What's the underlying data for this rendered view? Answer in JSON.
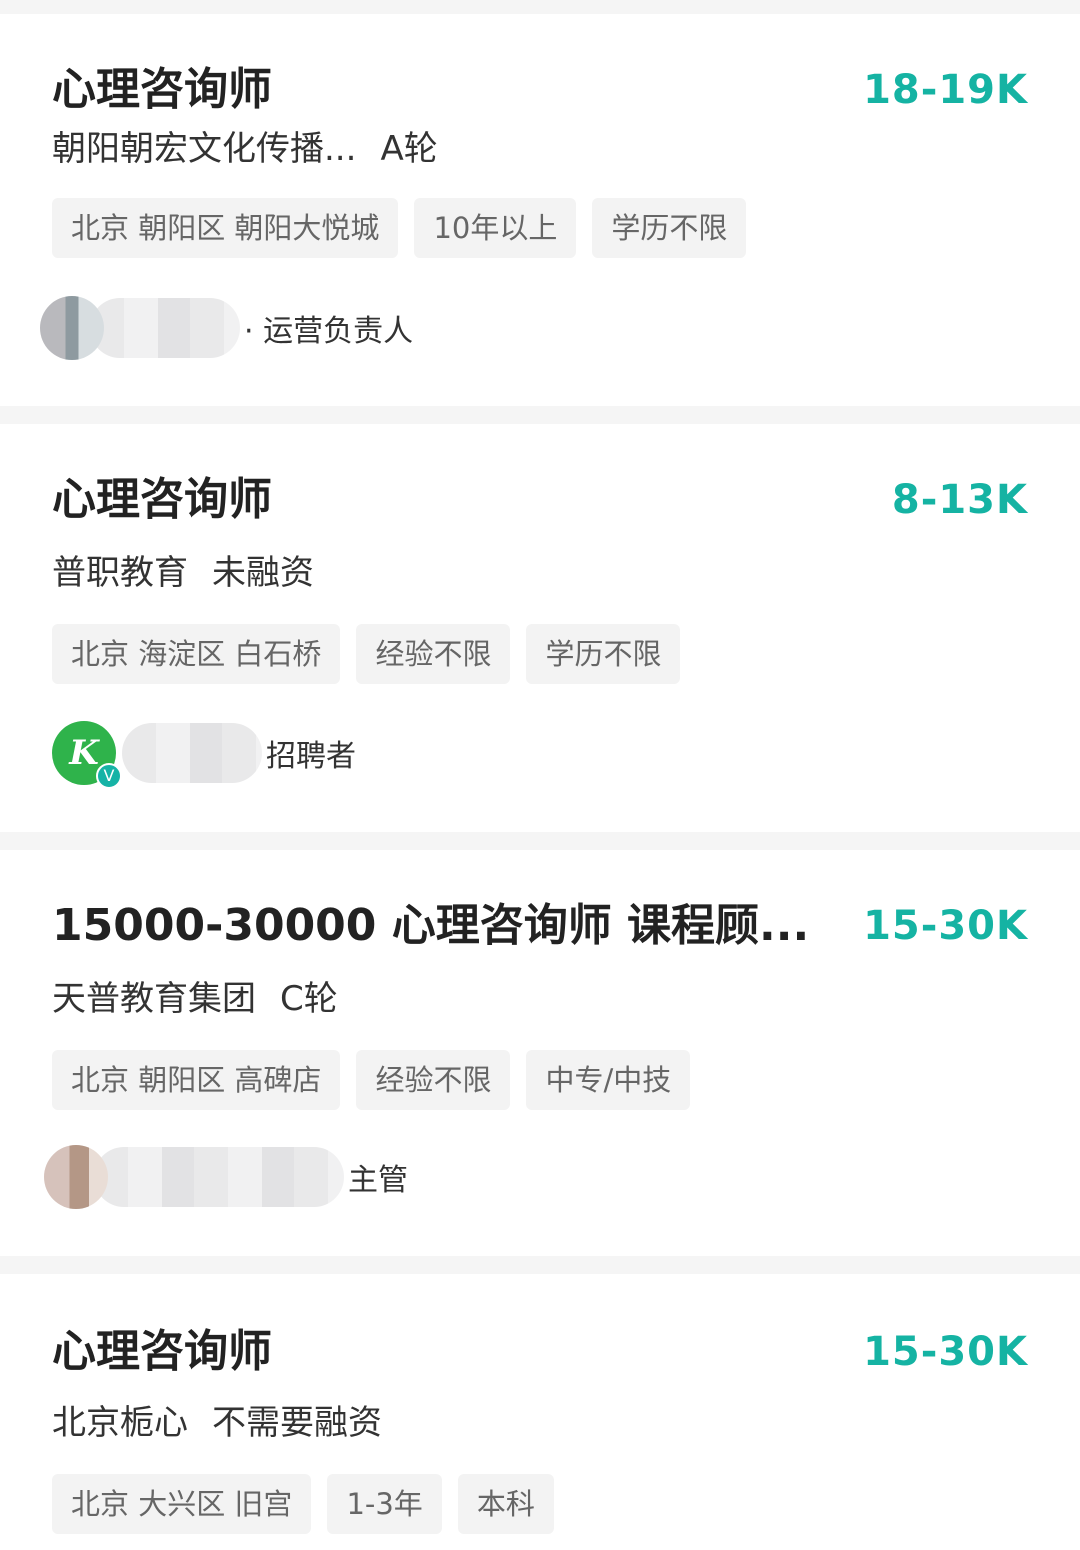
{
  "jobs": [
    {
      "title": "心理咨询师",
      "salary": "18-19K",
      "company": "朝阳朝宏文化传播...",
      "stage": "A轮",
      "tags": [
        "北京 朝阳区 朝阳大悦城",
        "10年以上",
        "学历不限"
      ],
      "recruiter_text": "· 运营负责人"
    },
    {
      "title": "心理咨询师",
      "salary": "8-13K",
      "company": "普职教育",
      "stage": "未融资",
      "tags": [
        "北京 海淀区 白石桥",
        "经验不限",
        "学历不限"
      ],
      "recruiter_text": "招聘者",
      "verified_badge": "V"
    },
    {
      "title": "15000-30000 心理咨询师 课程顾...",
      "salary": "15-30K",
      "company": "天普教育集团",
      "stage": "C轮",
      "tags": [
        "北京 朝阳区 高碑店",
        "经验不限",
        "中专/中技"
      ],
      "recruiter_text": "主管"
    },
    {
      "title": "心理咨询师",
      "salary": "15-30K",
      "company": "北京栀心",
      "stage": "不需要融资",
      "tags": [
        "北京 大兴区 旧宫",
        "1-3年",
        "本科"
      ]
    }
  ],
  "colors": {
    "salary": "#15b3a3",
    "background": "#f5f5f5",
    "tag_bg": "#f3f3f3"
  },
  "icons": {
    "company_logo": "k-logo-icon",
    "verified": "verified-badge-icon"
  }
}
